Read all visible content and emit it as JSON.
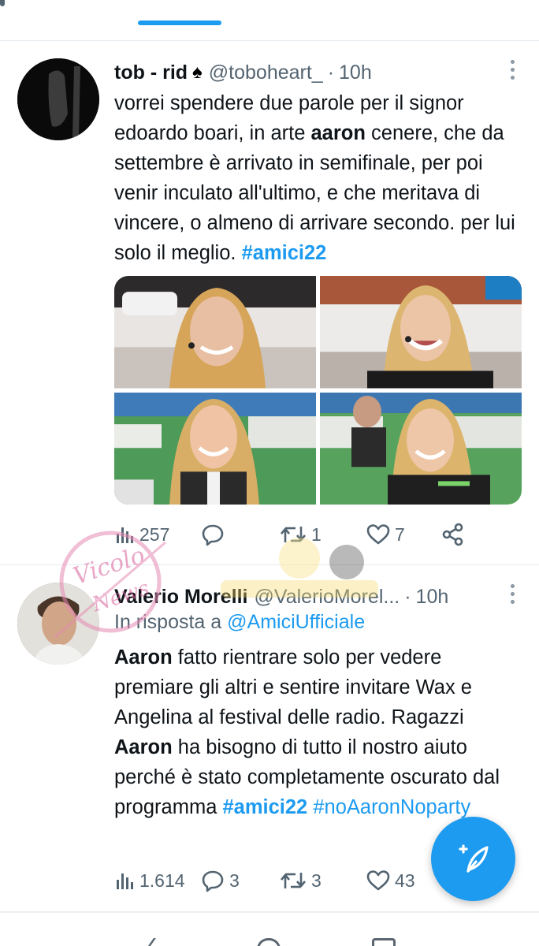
{
  "colors": {
    "accent": "#1d9bf0",
    "secondary_text": "#536471",
    "primary_text": "#0f1419"
  },
  "tweets": [
    {
      "name": "tob - rid",
      "name_emoji": "♠",
      "handle": "@toboheart_",
      "separator": "·",
      "time": "10h",
      "text_parts": [
        {
          "t": "vorrei spendere due parole per il signor edoardo boari, in arte "
        },
        {
          "t": "aaron",
          "style": "bold"
        },
        {
          "t": " cenere, che da settembre è arrivato in semifinale, per poi venir inculato all'ultimo, e che meritava di vincere, o almeno di arrivare secondo. per lui solo il meglio. "
        },
        {
          "t": "#amici22",
          "style": "hashtag"
        }
      ],
      "media_count": 4,
      "stats": {
        "views": "257",
        "replies": "",
        "retweets": "1",
        "likes": "7"
      }
    },
    {
      "name": "Valerio Morelli",
      "handle": "@ValerioMorel...",
      "separator": "·",
      "time": "10h",
      "reply_prefix": "In risposta a",
      "reply_target": "@AmiciUfficiale",
      "text_parts": [
        {
          "t": "Aaron",
          "style": "bold"
        },
        {
          "t": " fatto rientrare solo per vedere premiare gli altri e sentire invitare Wax e Angelina al festival delle radio. Ragazzi "
        },
        {
          "t": "Aaron",
          "style": "bold"
        },
        {
          "t": " ha bisogno di tutto il nostro aiuto perché è stato completamente oscurato dal programma "
        },
        {
          "t": "#amici22",
          "style": "hashtag"
        },
        {
          "t": " "
        },
        {
          "t": "#noAaronNoparty",
          "style": "hashtag"
        }
      ],
      "stats": {
        "views": "1.614",
        "replies": "3",
        "retweets": "3",
        "likes": "43"
      }
    }
  ],
  "watermark": {
    "text": "Vicolo delle News"
  },
  "icons": {
    "views": "views-icon",
    "reply": "reply-icon",
    "retweet": "retweet-icon",
    "like": "heart-icon",
    "share": "share-icon",
    "more": "more-icon",
    "compose": "compose-tweet-icon"
  }
}
